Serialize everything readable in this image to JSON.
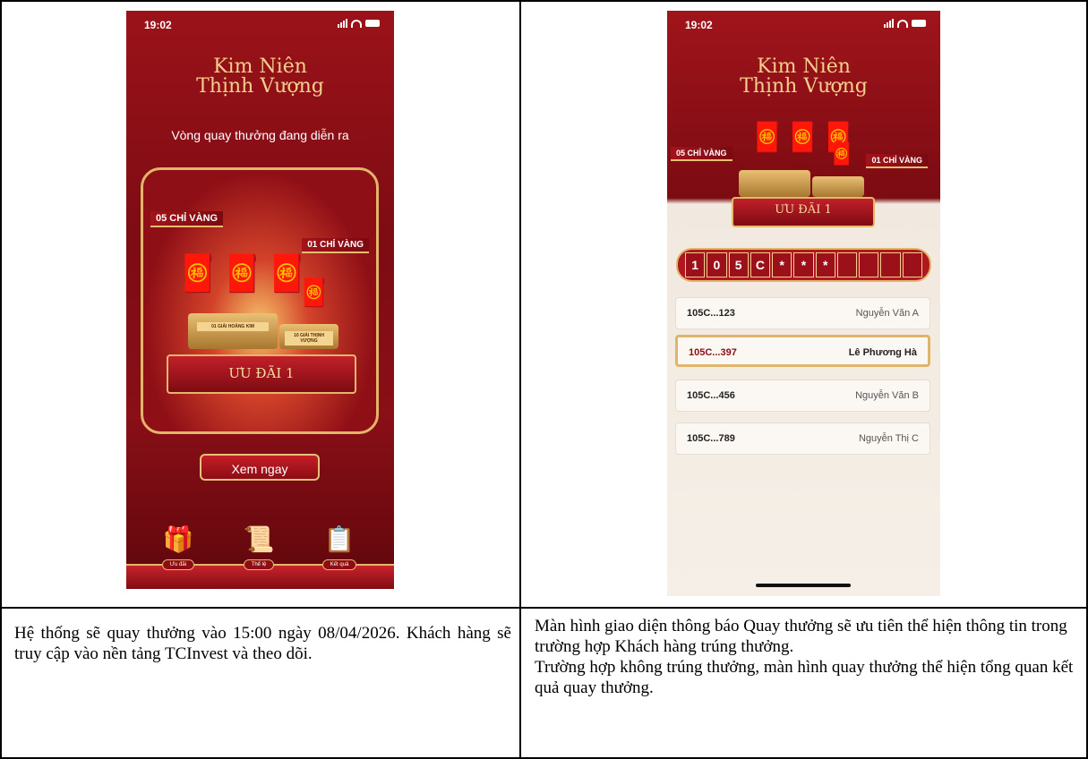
{
  "phone1": {
    "status_time": "19:02",
    "logo_line1": "Kim Niên",
    "logo_line2": "Thịnh Vượng",
    "subtitle": "Vòng quay thưởng đang diễn ra",
    "prize_big": "05 CHỈ VÀNG",
    "prize_small": "01 CHỈ VÀNG",
    "podium_label": "ƯU ĐÃI 1",
    "podium_left_tag": "01 GIẢI HOÀNG KIM",
    "podium_right_tag": "10 GIẢI THỊNH VƯỢNG",
    "cta": "Xem ngay",
    "nav": [
      {
        "label": "Ưu đãi",
        "icon": "gift-icon"
      },
      {
        "label": "Thể lệ",
        "icon": "scroll-icon"
      },
      {
        "label": "Kết quả",
        "icon": "result-check-icon"
      }
    ]
  },
  "phone2": {
    "status_time": "19:02",
    "logo_line1": "Kim Niên",
    "logo_line2": "Thịnh Vượng",
    "prize_big": "05 CHỈ VÀNG",
    "prize_small": "01 CHỈ VÀNG",
    "podium_label": "ƯU ĐÃI 1",
    "code_chars": [
      "1",
      "0",
      "5",
      "C",
      "*",
      "*",
      "*",
      "",
      "",
      "",
      ""
    ],
    "results": [
      {
        "code": "105C...123",
        "name": "Nguyễn Văn A",
        "highlight": false
      },
      {
        "code": "105C...397",
        "name": "Lê Phương Hà",
        "highlight": true
      },
      {
        "code": "105C...456",
        "name": "Nguyễn Văn B",
        "highlight": false
      },
      {
        "code": "105C...789",
        "name": "Nguyễn Thị C",
        "highlight": false
      }
    ]
  },
  "text_left": "Hệ thống sẽ quay thưởng vào 15:00 ngày 08/04/2026. Khách hàng sẽ truy cập vào nền tảng TCInvest và theo dõi.",
  "text_right": "Màn hình giao diện thông báo Quay thưởng sẽ ưu tiên thể hiện thông tin trong trường hợp Khách hàng trúng thưởng.\nTrường hợp không trúng thưởng, màn hình quay thưởng thể hiện tổng quan kết quả quay thưởng."
}
